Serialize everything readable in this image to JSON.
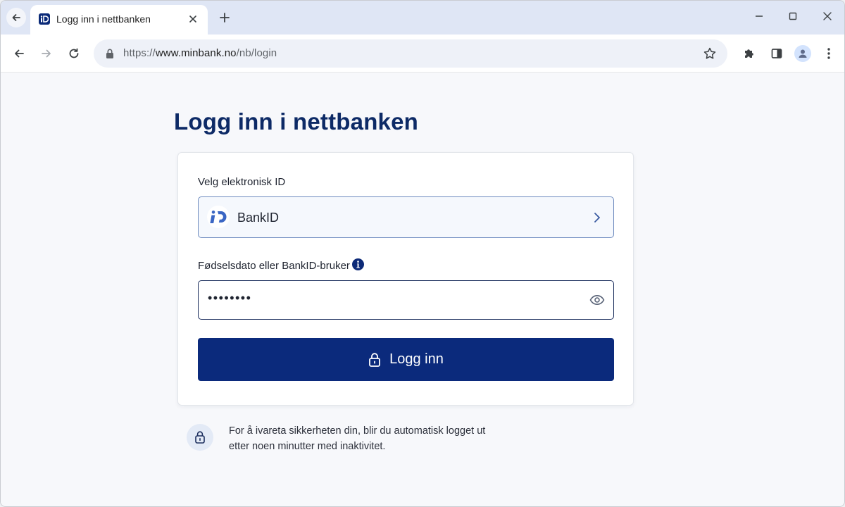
{
  "browser": {
    "tab_title": "Logg inn i nettbanken",
    "url_scheme": "https://",
    "url_host": "www.minbank.no",
    "url_path": "/nb/login"
  },
  "page": {
    "title": "Logg inn i nettbanken",
    "eid_label": "Velg elektronisk ID",
    "eid_selected": "BankID",
    "user_label": "Fødselsdato eller BankID-bruker",
    "password_masked": "••••••••",
    "login_button": "Logg inn",
    "notice_line1": "For å ivareta sikkerheten din, blir du automatisk logget ut",
    "notice_line2": "etter noen minutter med inaktivitet."
  },
  "colors": {
    "brand_navy": "#0b2a7c",
    "title_navy": "#0d2a66",
    "select_border": "#6e8bbf"
  }
}
